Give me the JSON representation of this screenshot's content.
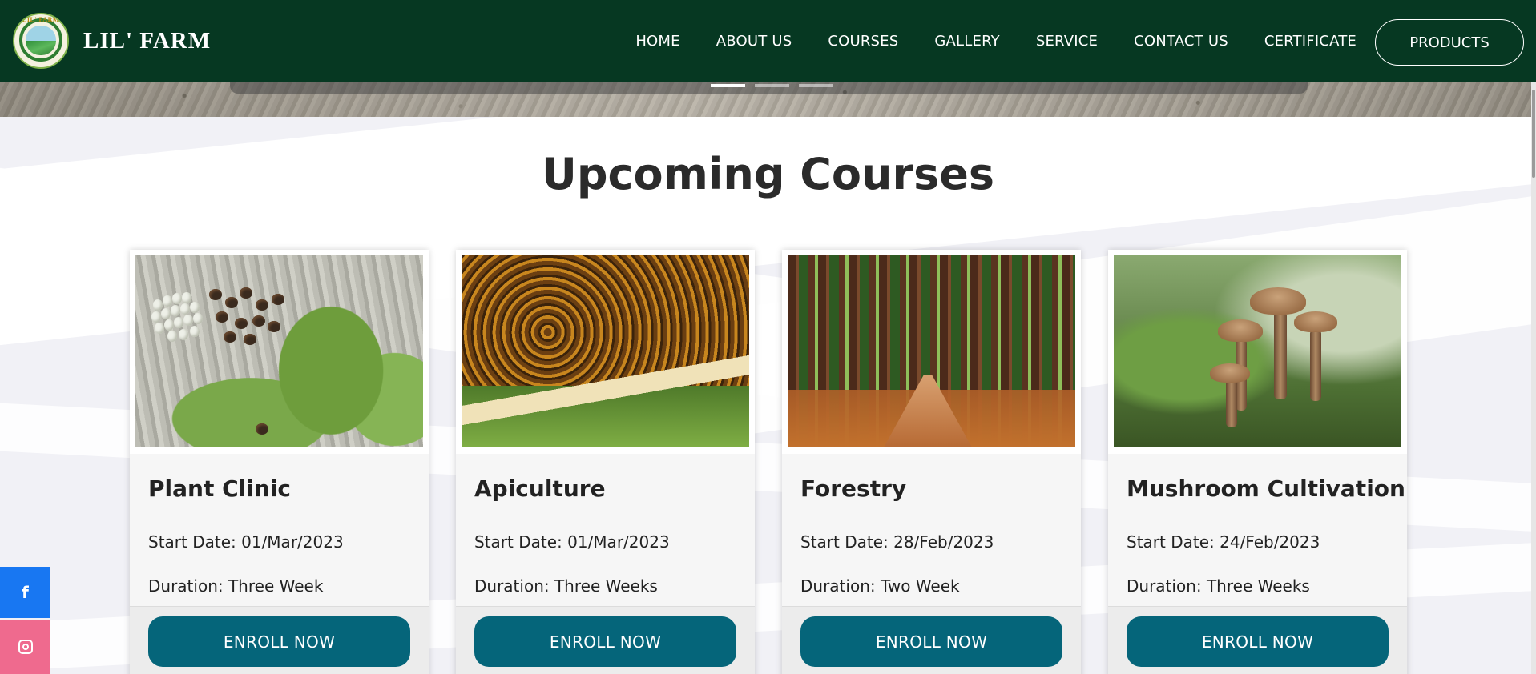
{
  "brand": {
    "name": "LIL' FARM",
    "logo_text": "LIL' FARM",
    "logo_icon": "farm-logo-icon"
  },
  "nav": {
    "items": [
      {
        "label": "HOME"
      },
      {
        "label": "ABOUT US"
      },
      {
        "label": "COURSES"
      },
      {
        "label": "GALLERY"
      },
      {
        "label": "SERVICE"
      },
      {
        "label": "CONTACT US"
      },
      {
        "label": "CERTIFICATE"
      }
    ],
    "products_label": "PRODUCTS"
  },
  "carousel": {
    "slides": 3,
    "active_index": 0
  },
  "section": {
    "title": "Upcoming Courses"
  },
  "courses": [
    {
      "title": "Plant Clinic",
      "start": "Start Date: 01/Mar/2023",
      "duration": "Duration: Three Week",
      "image": "leaf-with-insect-eggs",
      "enroll_label": "ENROLL NOW"
    },
    {
      "title": "Apiculture",
      "start": "Start Date: 01/Mar/2023",
      "duration": "Duration: Three Weeks",
      "image": "honeybees-on-comb",
      "enroll_label": "ENROLL NOW"
    },
    {
      "title": "Forestry",
      "start": "Start Date: 28/Feb/2023",
      "duration": "Duration: Two Week",
      "image": "forest-path",
      "enroll_label": "ENROLL NOW"
    },
    {
      "title": "Mushroom Cultivation",
      "start": "Start Date: 24/Feb/2023",
      "duration": "Duration: Three Weeks",
      "image": "mushrooms-on-log",
      "enroll_label": "ENROLL NOW"
    }
  ],
  "social": {
    "facebook_icon": "facebook-icon",
    "instagram_icon": "instagram-icon"
  },
  "colors": {
    "navbar": "#063822",
    "enroll_button": "#05657a",
    "facebook": "#1877f2",
    "instagram": "#ef6a8e"
  }
}
